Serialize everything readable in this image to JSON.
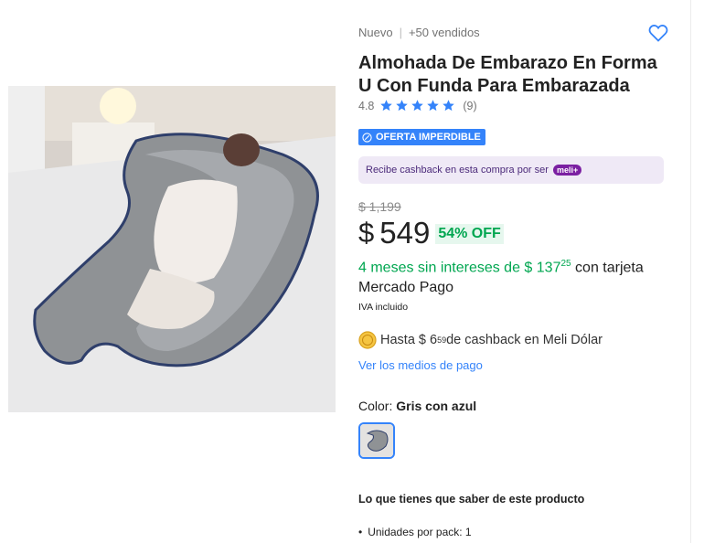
{
  "product": {
    "condition": "Nuevo",
    "sold": "+50 vendidos",
    "title": "Almohada De Embarazo En Forma U Con Funda Para Embarazada",
    "rating": "4.8",
    "reviews": "(9)",
    "rating_stars": 4.8,
    "badge": "OFERTA IMPERDIBLE"
  },
  "cashback": {
    "text": "Recibe cashback en esta compra por ser",
    "brand": "meli+"
  },
  "price": {
    "old": "$ 1,199",
    "currency": "$",
    "amount": "549",
    "discount": "54% OFF"
  },
  "installments": {
    "lead": "4 meses sin intereses de $ 137",
    "cents": "25",
    "tail": " con tarjeta Mercado Pago",
    "iva": "IVA incluido"
  },
  "meli_dolar": {
    "lead": "Hasta $ 6",
    "cents": "59",
    "tail": " de cashback en Meli Dólar"
  },
  "payment_link": "Ver los medios de pago",
  "color": {
    "label": "Color:",
    "value": "Gris con azul"
  },
  "info": {
    "title": "Lo que tienes que saber de este producto",
    "bullets": [
      "Unidades por pack: 1"
    ]
  },
  "colors": {
    "accent": "#3483fa",
    "green": "#00a650",
    "purple_bg": "#efe9f6"
  }
}
